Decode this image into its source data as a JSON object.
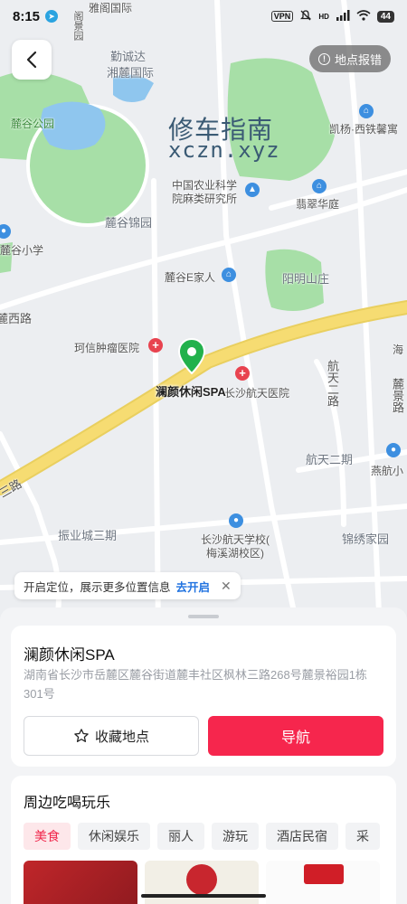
{
  "status_bar": {
    "time": "8:15",
    "vpn": "VPN",
    "network": "HD",
    "battery": "44",
    "icons": [
      "telegram-icon",
      "mute-icon",
      "signal-icon",
      "wifi-icon",
      "battery-icon"
    ]
  },
  "map": {
    "watermark_title": "修车指南",
    "watermark_url": "xczn.xyz",
    "labels": {
      "yage": "雅阁国际",
      "jingyuan": "阁景园",
      "qinchengda": "勤诚达",
      "xianglu": "湘麓国际",
      "lugu_park": "麓谷公园",
      "kaiyang": "凯杨·西铁馨寓",
      "agri_inst": "中国农业科学",
      "agri_inst2": "院麻类研究所",
      "feicui": "翡翠华庭",
      "lugu_jinyuan": "麓谷锦园",
      "lugu_school": "麓谷小学",
      "lugu_ejiaren": "麓谷E家人",
      "yangming": "阳明山庄",
      "luxi_road": "麓西路",
      "kexin": "珂信肿瘤医院",
      "hangtian_hospital": "长沙航天医院",
      "hai": "海",
      "hangtian_2road": "航天二路",
      "lujing_road": "麓景路",
      "hangtian_2qi": "航天二期",
      "yanhang": "燕航小",
      "zhenye": "振业城三期",
      "hangtian_school": "长沙航天学校(",
      "hangtian_school2": "梅溪湖校区)",
      "jinxiu": "锦绣家园",
      "san_road": "三路"
    },
    "pin_label": "澜颜休闲SPA"
  },
  "controls": {
    "back_label": "back",
    "report_label": "地点报错"
  },
  "location_tip": {
    "text": "开启定位，展示更多位置信息",
    "link": "去开启",
    "close": "✕"
  },
  "place": {
    "name": "澜颜休闲SPA",
    "address": "湖南省长沙市岳麓区麓谷街道麓丰社区枫林三路268号麓景裕园1栋301号",
    "favorite_label": "收藏地点",
    "navigate_label": "导航"
  },
  "nearby": {
    "title": "周边吃喝玩乐",
    "categories": [
      "美食",
      "休闲娱乐",
      "丽人",
      "游玩",
      "酒店民宿",
      "采"
    ],
    "active_category": "美食"
  },
  "colors": {
    "accent_red": "#f6264d",
    "link_blue": "#2173e0",
    "pin_green": "#22b14c",
    "road_yellow": "#f6dc72",
    "park_green": "#a7dfa7"
  }
}
